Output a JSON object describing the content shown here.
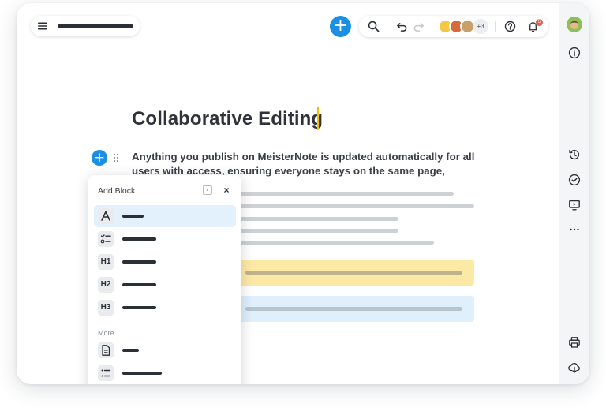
{
  "document": {
    "title": "Collaborative Editing",
    "paragraph": "Anything you publish on MeisterNote is updated automatically for all users with access, ensuring everyone stays on the same page, wherever they are."
  },
  "toolbar": {
    "add_label": "+",
    "collaborators_more": "+3",
    "notifications_count": "5"
  },
  "add_block_menu": {
    "title": "Add Block",
    "shortcut": "/",
    "close_label": "×",
    "section_more": "More",
    "items": [
      {
        "icon": "A",
        "icon_name": "text-icon"
      },
      {
        "icon": "☑",
        "icon_name": "checklist-icon"
      },
      {
        "icon": "H1",
        "icon_name": "heading-1-icon"
      },
      {
        "icon": "H2",
        "icon_name": "heading-2-icon"
      },
      {
        "icon": "H3",
        "icon_name": "heading-3-icon"
      }
    ],
    "more_items": [
      {
        "icon": "page",
        "icon_name": "page-icon"
      },
      {
        "icon": "list",
        "icon_name": "bullet-list-icon"
      }
    ]
  },
  "colors": {
    "accent": "#1a8fe3",
    "caret": "#f2c200",
    "callout_yellow": "#fde9a6",
    "callout_blue": "#dff0fc"
  }
}
